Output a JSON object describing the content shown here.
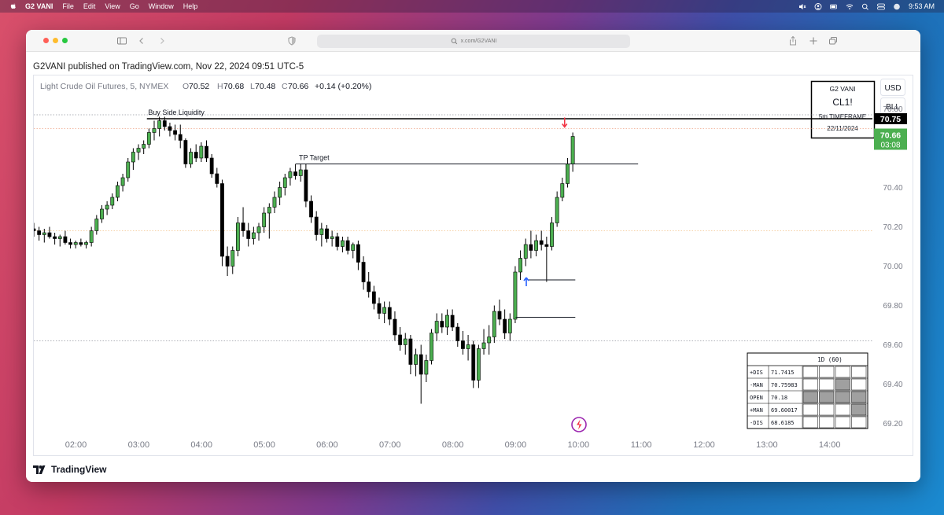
{
  "menubar": {
    "app_name": "G2 VANI",
    "items": [
      "File",
      "Edit",
      "View",
      "Go",
      "Window",
      "Help"
    ],
    "time": "9:53 AM"
  },
  "browser": {
    "url": "x.com/G2VANI"
  },
  "header": {
    "published": "G2VANI published on TradingView.com, Nov 22, 2024 09:51 UTC-5"
  },
  "footer": {
    "brand": "TradingView"
  },
  "chart_data": {
    "type": "candlestick",
    "symbol_line": {
      "name": "Light Crude Oil Futures, 5, NYMEX",
      "o_label": "O",
      "o": "70.52",
      "h_label": "H",
      "h": "70.68",
      "l_label": "L",
      "l": "70.48",
      "c_label": "C",
      "c": "70.66",
      "change": "+0.14 (+0.20%)"
    },
    "info_box": {
      "author": "G2 VANI",
      "ticker": "CL1!",
      "timeframe": "5m TIMEFRAME",
      "date": "22/11/2024"
    },
    "currency": "USD",
    "unit": "BLL",
    "price_badges": {
      "liquidity_price": "70.75",
      "last_price": "70.66",
      "countdown": "03:08"
    },
    "y_ticks": [
      "70.80",
      "70.40",
      "70.20",
      "70.00",
      "69.80",
      "69.60",
      "69.40",
      "69.20"
    ],
    "y_tick_values": [
      70.8,
      70.4,
      70.2,
      70.0,
      69.8,
      69.6,
      69.4,
      69.2
    ],
    "x_ticks": [
      "02:00",
      "03:00",
      "04:00",
      "05:00",
      "06:00",
      "07:00",
      "08:00",
      "09:00",
      "10:00",
      "11:00",
      "12:00",
      "13:00",
      "14:00"
    ],
    "x_tick_hours": [
      2,
      3,
      4,
      5,
      6,
      7,
      8,
      9,
      10,
      11,
      12,
      13,
      14
    ],
    "ylim": [
      69.15,
      70.97
    ],
    "xlim_hours": [
      1.33,
      14.68
    ],
    "annotations": {
      "buy_side_liquidity": {
        "label": "Buy Side Liquidity",
        "price": 70.75
      },
      "tp_target": {
        "label": "TP Target",
        "price": 70.52
      },
      "level_low": {
        "price": 69.93
      },
      "level_low2": {
        "price": 69.74
      }
    },
    "reference_levels": [
      70.7,
      70.18,
      69.62,
      70.77
    ],
    "candles_start_hour": 1.33,
    "candle_interval_hours": 0.0833,
    "candles": [
      [
        70.19,
        70.22,
        70.15,
        70.18
      ],
      [
        70.18,
        70.2,
        70.13,
        70.16
      ],
      [
        70.16,
        70.19,
        70.12,
        70.17
      ],
      [
        70.17,
        70.2,
        70.14,
        70.15
      ],
      [
        70.15,
        70.17,
        70.11,
        70.14
      ],
      [
        70.14,
        70.16,
        70.1,
        70.15
      ],
      [
        70.15,
        70.18,
        70.11,
        70.12
      ],
      [
        70.12,
        70.14,
        70.09,
        70.11
      ],
      [
        70.11,
        70.13,
        70.09,
        70.12
      ],
      [
        70.12,
        70.14,
        70.1,
        70.11
      ],
      [
        70.11,
        70.13,
        70.09,
        70.12
      ],
      [
        70.12,
        70.2,
        70.1,
        70.18
      ],
      [
        70.18,
        70.26,
        70.16,
        70.24
      ],
      [
        70.24,
        70.31,
        70.22,
        70.29
      ],
      [
        70.29,
        70.33,
        70.26,
        70.31
      ],
      [
        70.31,
        70.37,
        70.29,
        70.35
      ],
      [
        70.35,
        70.43,
        70.33,
        70.41
      ],
      [
        70.41,
        70.47,
        70.38,
        70.45
      ],
      [
        70.45,
        70.55,
        70.43,
        70.53
      ],
      [
        70.53,
        70.6,
        70.49,
        70.58
      ],
      [
        70.58,
        70.62,
        70.54,
        70.6
      ],
      [
        70.6,
        70.64,
        70.57,
        70.62
      ],
      [
        70.62,
        70.7,
        70.6,
        70.68
      ],
      [
        70.68,
        70.74,
        70.64,
        70.7
      ],
      [
        70.7,
        70.76,
        70.66,
        70.74
      ],
      [
        70.74,
        70.76,
        70.69,
        70.71
      ],
      [
        70.71,
        70.73,
        70.66,
        70.69
      ],
      [
        70.69,
        70.72,
        70.64,
        70.67
      ],
      [
        70.67,
        70.72,
        70.6,
        70.64
      ],
      [
        70.64,
        70.65,
        70.5,
        70.52
      ],
      [
        70.52,
        70.6,
        70.5,
        70.58
      ],
      [
        70.58,
        70.62,
        70.53,
        70.55
      ],
      [
        70.55,
        70.63,
        70.53,
        70.61
      ],
      [
        70.61,
        70.64,
        70.53,
        70.55
      ],
      [
        70.55,
        70.57,
        70.45,
        70.47
      ],
      [
        70.47,
        70.5,
        70.4,
        70.42
      ],
      [
        70.42,
        70.44,
        70.0,
        70.05
      ],
      [
        70.05,
        70.1,
        69.95,
        70.0
      ],
      [
        70.0,
        70.1,
        69.96,
        70.08
      ],
      [
        70.08,
        70.25,
        70.05,
        70.22
      ],
      [
        70.22,
        70.3,
        70.15,
        70.18
      ],
      [
        70.18,
        70.22,
        70.1,
        70.14
      ],
      [
        70.14,
        70.2,
        70.11,
        70.17
      ],
      [
        70.17,
        70.22,
        70.13,
        70.2
      ],
      [
        70.2,
        70.3,
        70.17,
        70.27
      ],
      [
        70.27,
        70.32,
        70.14,
        70.3
      ],
      [
        70.3,
        70.38,
        70.27,
        70.35
      ],
      [
        70.35,
        70.43,
        70.31,
        70.4
      ],
      [
        70.4,
        70.47,
        70.36,
        70.45
      ],
      [
        70.45,
        70.5,
        70.41,
        70.48
      ],
      [
        70.48,
        70.52,
        70.44,
        70.46
      ],
      [
        70.46,
        70.52,
        70.43,
        70.49
      ],
      [
        70.49,
        70.52,
        70.3,
        70.33
      ],
      [
        70.33,
        70.36,
        70.22,
        70.25
      ],
      [
        70.25,
        70.28,
        70.13,
        70.16
      ],
      [
        70.16,
        70.22,
        70.1,
        70.19
      ],
      [
        70.19,
        70.21,
        70.12,
        70.14
      ],
      [
        70.14,
        70.18,
        70.1,
        70.15
      ],
      [
        70.15,
        70.17,
        70.08,
        70.1
      ],
      [
        70.1,
        70.15,
        70.07,
        70.13
      ],
      [
        70.13,
        70.15,
        70.06,
        70.08
      ],
      [
        70.08,
        70.12,
        70.04,
        70.11
      ],
      [
        70.11,
        70.13,
        69.98,
        70.02
      ],
      [
        70.02,
        70.05,
        69.88,
        69.92
      ],
      [
        69.92,
        69.97,
        69.84,
        69.87
      ],
      [
        69.87,
        69.9,
        69.78,
        69.81
      ],
      [
        69.81,
        69.84,
        69.73,
        69.76
      ],
      [
        69.76,
        69.82,
        69.71,
        69.79
      ],
      [
        69.79,
        69.82,
        69.7,
        69.73
      ],
      [
        69.73,
        69.77,
        69.62,
        69.65
      ],
      [
        69.65,
        69.69,
        69.57,
        69.6
      ],
      [
        69.6,
        69.66,
        69.55,
        69.63
      ],
      [
        69.63,
        69.65,
        69.45,
        69.5
      ],
      [
        69.5,
        69.58,
        69.44,
        69.55
      ],
      [
        69.55,
        69.6,
        69.3,
        69.45
      ],
      [
        69.45,
        69.55,
        69.41,
        69.52
      ],
      [
        69.52,
        69.68,
        69.5,
        69.66
      ],
      [
        69.66,
        69.76,
        69.62,
        69.72
      ],
      [
        69.72,
        69.76,
        69.66,
        69.69
      ],
      [
        69.69,
        69.78,
        69.65,
        69.75
      ],
      [
        69.75,
        69.78,
        69.67,
        69.69
      ],
      [
        69.69,
        69.71,
        69.59,
        69.62
      ],
      [
        69.62,
        69.67,
        69.55,
        69.58
      ],
      [
        69.58,
        69.65,
        69.52,
        69.6
      ],
      [
        69.6,
        69.62,
        69.38,
        69.42
      ],
      [
        69.42,
        69.6,
        69.38,
        69.58
      ],
      [
        69.58,
        69.68,
        69.55,
        69.61
      ],
      [
        69.61,
        69.7,
        69.55,
        69.64
      ],
      [
        69.64,
        69.8,
        69.61,
        69.77
      ],
      [
        69.77,
        69.83,
        69.7,
        69.73
      ],
      [
        69.73,
        69.78,
        69.63,
        69.66
      ],
      [
        69.66,
        69.76,
        69.62,
        69.73
      ],
      [
        69.73,
        70.0,
        69.71,
        69.97
      ],
      [
        69.97,
        70.08,
        69.93,
        70.04
      ],
      [
        70.04,
        70.14,
        70.0,
        70.11
      ],
      [
        70.11,
        70.18,
        70.04,
        70.08
      ],
      [
        70.08,
        70.16,
        70.05,
        70.13
      ],
      [
        70.13,
        70.18,
        70.08,
        70.11
      ],
      [
        70.11,
        70.15,
        69.92,
        70.1
      ],
      [
        70.1,
        70.25,
        70.08,
        70.22
      ],
      [
        70.22,
        70.38,
        70.2,
        70.35
      ],
      [
        70.35,
        70.45,
        70.33,
        70.42
      ],
      [
        70.42,
        70.55,
        70.4,
        70.52
      ],
      [
        70.52,
        70.68,
        70.48,
        70.66
      ]
    ],
    "markers": [
      {
        "type": "arrow-up",
        "color": "#2962ff",
        "hour": 9.17,
        "price": 69.95
      },
      {
        "type": "arrow-down",
        "color": "#f23645",
        "hour": 9.78,
        "price": 70.7
      }
    ],
    "colors": {
      "up": "#4caf50",
      "down": "#000000",
      "liquidity_line": "#000000",
      "badge_green": "#4caf50"
    },
    "levels_table": {
      "header": "1D (60)",
      "rows": [
        {
          "label": "+DIS",
          "value": "71.7415",
          "cells": [
            false,
            false,
            false,
            false
          ]
        },
        {
          "label": "-MAN",
          "value": "70.75983",
          "cells": [
            false,
            false,
            true,
            false
          ]
        },
        {
          "label": "OPEN",
          "value": "70.18",
          "cells": [
            true,
            true,
            true,
            true
          ]
        },
        {
          "label": "+MAN",
          "value": "69.60017",
          "cells": [
            false,
            false,
            false,
            true
          ]
        },
        {
          "label": "-DIS",
          "value": "68.6185",
          "cells": [
            false,
            false,
            false,
            false
          ]
        }
      ],
      "cell_fill": "#a0a0a0"
    }
  }
}
